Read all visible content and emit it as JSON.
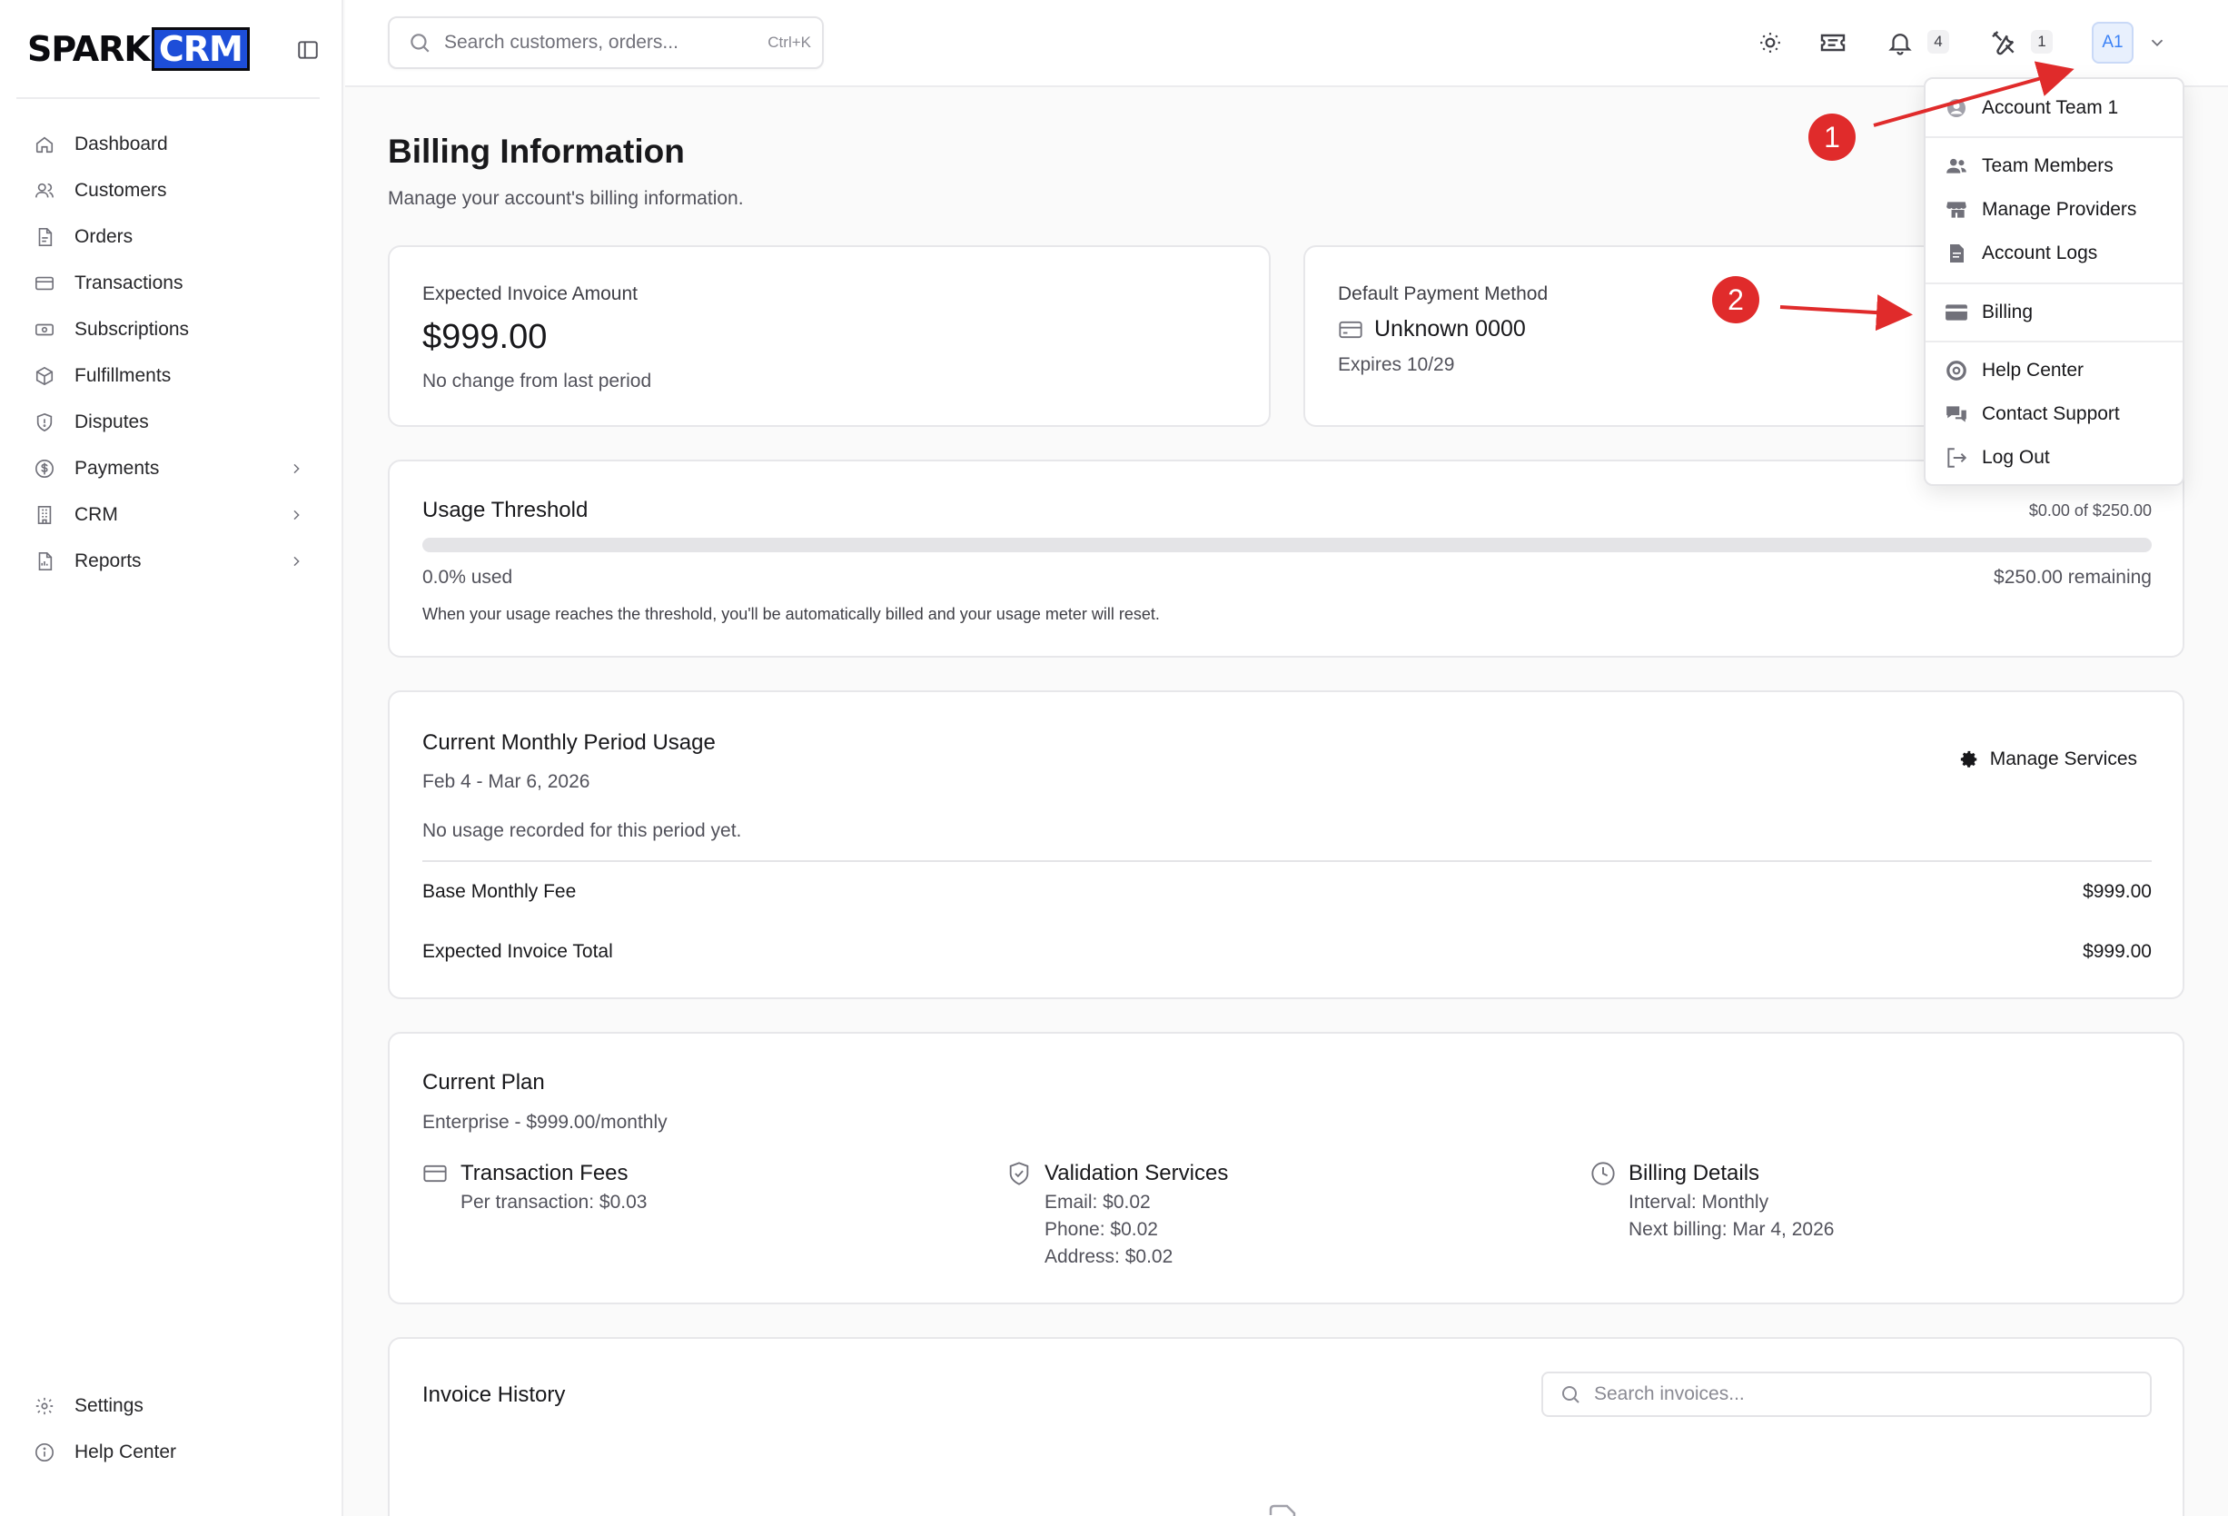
{
  "app": {
    "logo_part1": "SPARK",
    "logo_part2": "CRM"
  },
  "sidebar": {
    "items": [
      {
        "label": "Dashboard",
        "icon": "home-icon"
      },
      {
        "label": "Customers",
        "icon": "users-icon"
      },
      {
        "label": "Orders",
        "icon": "file-icon"
      },
      {
        "label": "Transactions",
        "icon": "credit-card-icon"
      },
      {
        "label": "Subscriptions",
        "icon": "banknote-icon"
      },
      {
        "label": "Fulfillments",
        "icon": "package-icon"
      },
      {
        "label": "Disputes",
        "icon": "shield-icon"
      },
      {
        "label": "Payments",
        "icon": "dollar-circle-icon"
      },
      {
        "label": "CRM",
        "icon": "building-icon"
      },
      {
        "label": "Reports",
        "icon": "report-icon"
      }
    ],
    "bottom": [
      {
        "label": "Settings",
        "icon": "gear-icon"
      },
      {
        "label": "Help Center",
        "icon": "info-icon"
      }
    ]
  },
  "topbar": {
    "search_placeholder": "Search customers, orders...",
    "search_shortcut": "Ctrl+K",
    "notifications_count": "4",
    "tools_count": "1",
    "avatar_initials": "A1"
  },
  "page": {
    "title": "Billing Information",
    "subtitle": "Manage your account's billing information."
  },
  "invoice_card": {
    "label": "Expected Invoice Amount",
    "amount": "$999.00",
    "note": "No change from last period"
  },
  "payment_card": {
    "label": "Default Payment Method",
    "method": "Unknown 0000",
    "expires": "Expires 10/29"
  },
  "usage": {
    "title": "Usage Threshold",
    "amount_of": "$0.00 of $250.00",
    "used": "0.0% used",
    "used_fraction": 0.0,
    "remaining": "$250.00 remaining",
    "note": "When your usage reaches the threshold, you'll be automatically billed and your usage meter will reset."
  },
  "period": {
    "title": "Current Monthly Period Usage",
    "dates": "Feb 4 - Mar 6, 2026",
    "manage_label": "Manage Services",
    "empty": "No usage recorded for this period yet.",
    "base_label": "Base Monthly Fee",
    "base_value": "$999.00",
    "total_label": "Expected Invoice Total",
    "total_value": "$999.00"
  },
  "plan": {
    "title": "Current Plan",
    "subtitle": "Enterprise - $999.00/monthly",
    "columns": [
      {
        "title": "Transaction Fees",
        "lines": [
          "Per transaction: $0.03"
        ]
      },
      {
        "title": "Validation Services",
        "lines": [
          "Email: $0.02",
          "Phone: $0.02",
          "Address: $0.02"
        ]
      },
      {
        "title": "Billing Details",
        "lines": [
          "Interval: Monthly",
          "Next billing: Mar 4, 2026"
        ]
      }
    ]
  },
  "invoices": {
    "title": "Invoice History",
    "search_placeholder": "Search invoices..."
  },
  "menu": {
    "items": [
      {
        "label": "Account Team 1",
        "icon": "user-circle-icon"
      },
      {
        "label": "Team Members",
        "icon": "team-icon"
      },
      {
        "label": "Manage Providers",
        "icon": "store-icon"
      },
      {
        "label": "Account Logs",
        "icon": "document-icon"
      },
      {
        "label": "Billing",
        "icon": "card-icon"
      },
      {
        "label": "Help Center",
        "icon": "lifebuoy-icon"
      },
      {
        "label": "Contact Support",
        "icon": "chat-icon"
      },
      {
        "label": "Log Out",
        "icon": "logout-icon"
      }
    ]
  },
  "annotations": [
    "1",
    "2"
  ],
  "colors": {
    "brand": "#1d4ed8",
    "annotation": "#e02b2b"
  }
}
